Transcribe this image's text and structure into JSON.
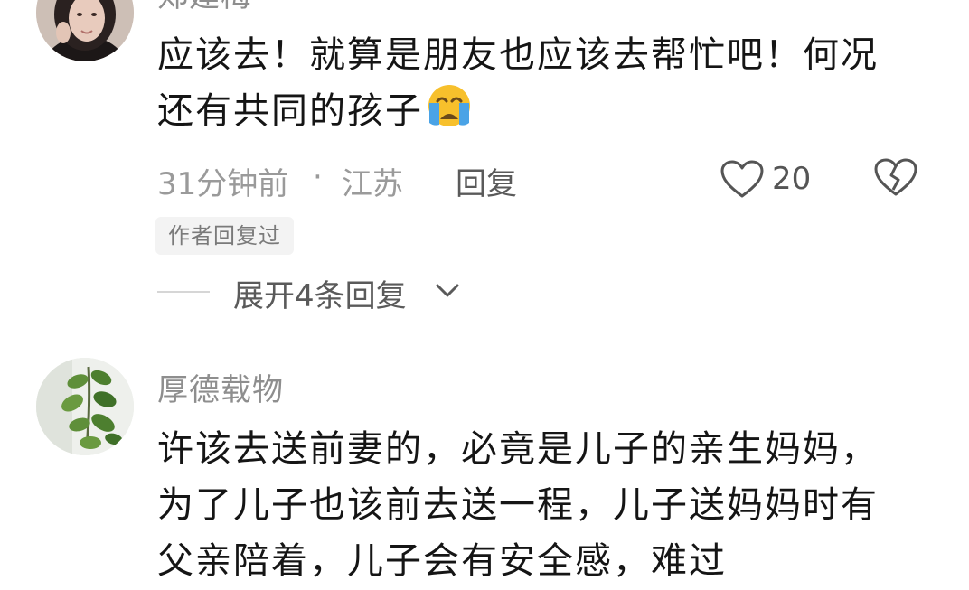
{
  "comments": [
    {
      "username": "郑建梅",
      "text": "应该去！就算是朋友也应该去帮忙吧！何况还有共同的孩子",
      "emoji": "crying-face-icon",
      "time": "31分钟前",
      "separator": "·",
      "location": "江苏",
      "reply_label": "回复",
      "likes": "20",
      "author_tag": "作者回复过",
      "expand_label": "展开4条回复"
    },
    {
      "username": "厚德载物",
      "text": "许该去送前妻的，必竟是儿子的亲生妈妈，为了儿子也该前去送一程，儿子送妈妈时有父亲陪着，儿子会有安全感，难过"
    }
  ],
  "colors": {
    "text_primary": "#151515",
    "text_secondary": "#9a9a9a",
    "tag_bg": "#f3f3f3",
    "emoji_yellow": "#f7c02c",
    "tear_blue": "#4aa3e6"
  }
}
